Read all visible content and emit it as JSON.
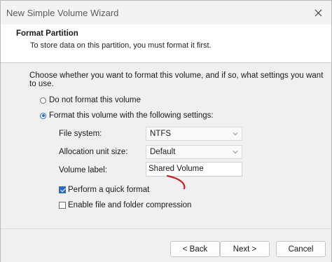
{
  "window": {
    "title": "New Simple Volume Wizard",
    "close_icon": "close-icon"
  },
  "header": {
    "title": "Format Partition",
    "subtitle": "To store data on this partition, you must format it first."
  },
  "main": {
    "instruction": "Choose whether you want to format this volume, and if so, what settings you want to use.",
    "options": {
      "no_format": {
        "label": "Do not format this volume",
        "selected": false
      },
      "format": {
        "label": "Format this volume with the following settings:",
        "selected": true
      }
    },
    "fields": {
      "file_system": {
        "label": "File system:",
        "value": "NTFS"
      },
      "allocation_unit_size": {
        "label": "Allocation unit size:",
        "value": "Default"
      },
      "volume_label": {
        "label": "Volume label:",
        "value": "Shared Volume"
      }
    },
    "checkboxes": {
      "quick_format": {
        "label": "Perform a quick format",
        "checked": true
      },
      "compression": {
        "label": "Enable file and folder compression",
        "checked": false
      }
    }
  },
  "footer": {
    "back": "< Back",
    "next": "Next >",
    "cancel": "Cancel"
  },
  "colors": {
    "accent": "#2b6bbd",
    "annotation": "#c81e2a"
  }
}
